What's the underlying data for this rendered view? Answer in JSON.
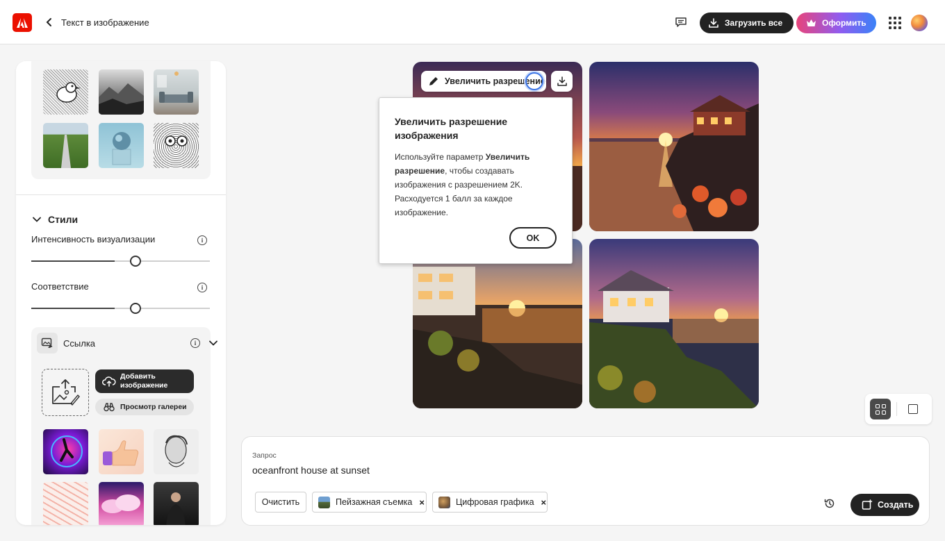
{
  "header": {
    "title": "Текст в изображение",
    "download_all_label": "Загрузить все",
    "upgrade_label": "Оформить"
  },
  "left_panel": {
    "styles_title": "Стили",
    "sliders": [
      {
        "label": "Интенсивность визуализации",
        "value_fraction": 0.5
      },
      {
        "label": "Соответствие",
        "value_fraction": 0.5
      }
    ],
    "reference": {
      "title": "Ссылка",
      "add_image_label_line1": "Добавить",
      "add_image_label_line2": "изображение",
      "gallery_label": "Просмотр галереи"
    }
  },
  "image_toolbar": {
    "upscale_label": "Увеличить разрешение"
  },
  "popover": {
    "title": "Увеличить разрешение изображения",
    "body_prefix": "Используйте параметр ",
    "body_bold": "Увеличить разрешение",
    "body_suffix": ", чтобы создавать изображения с разрешением 2K. Расходуется 1 балл за каждое изображение.",
    "ok_label": "OK"
  },
  "prompt": {
    "label": "Запрос",
    "text": "oceanfront house at sunset",
    "clear_label": "Очистить",
    "chips": [
      {
        "label": "Пейзажная съемка"
      },
      {
        "label": "Цифровая графика"
      }
    ],
    "generate_label": "Создать"
  },
  "colors": {
    "adobe_red": "#eb1000",
    "focus_blue": "#3b74e6",
    "dark_button": "#222222"
  }
}
